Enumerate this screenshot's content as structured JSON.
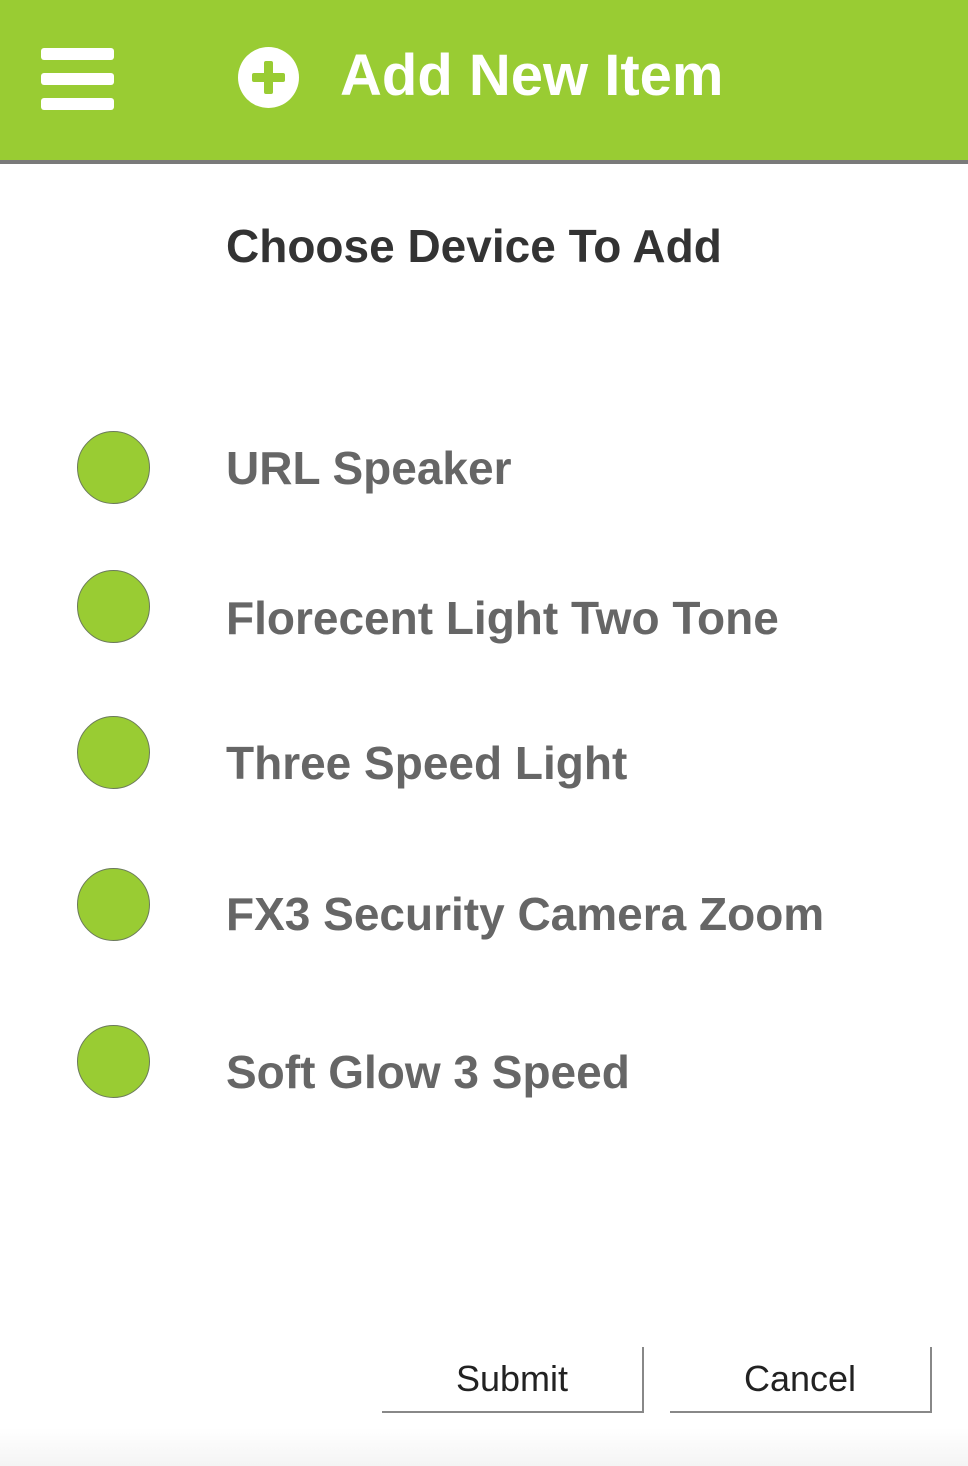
{
  "header": {
    "title": "Add New Item",
    "menu_icon": "hamburger-menu-icon",
    "title_icon": "plus-circle-icon",
    "background_color": "#99cc33"
  },
  "main": {
    "section_title": "Choose Device To Add",
    "devices": [
      {
        "label": "URL Speaker"
      },
      {
        "label": "Florecent Light Two Tone"
      },
      {
        "label": "Three Speed Light"
      },
      {
        "label": "FX3 Security Camera Zoom"
      },
      {
        "label": "Soft Glow 3 Speed"
      }
    ]
  },
  "actions": {
    "submit_label": "Submit",
    "cancel_label": "Cancel"
  },
  "colors": {
    "accent": "#99cc33",
    "label_text": "#666666",
    "title_text": "#333333"
  }
}
